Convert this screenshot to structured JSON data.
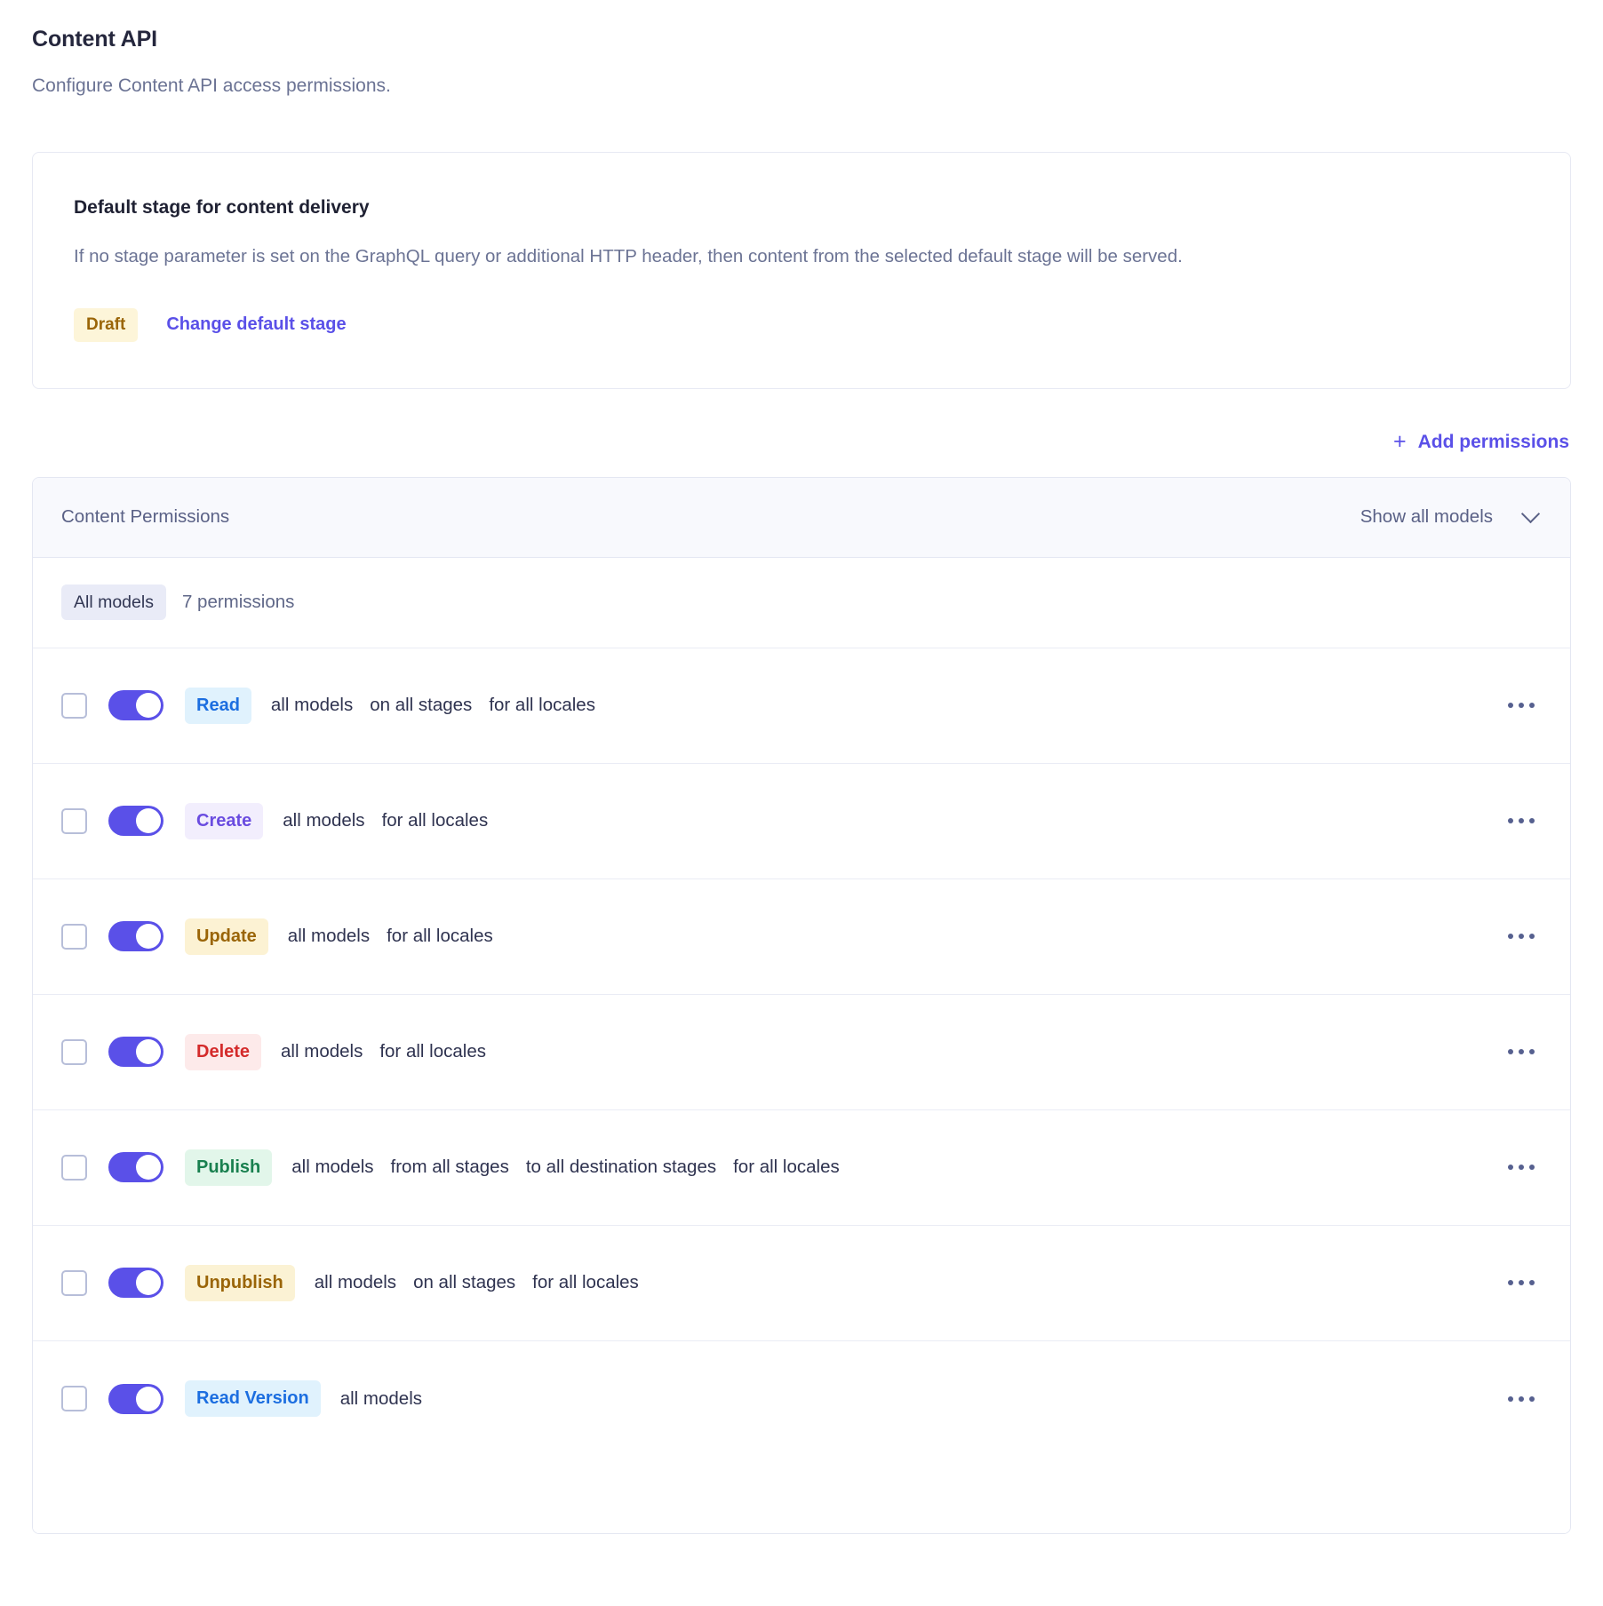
{
  "page": {
    "title": "Content API",
    "subtitle": "Configure Content API access permissions."
  },
  "default_stage_card": {
    "title": "Default stage for content delivery",
    "description": "If no stage parameter is set on the GraphQL query or additional HTTP header, then content from the selected default stage will be served.",
    "stage_badge": "Draft",
    "change_link": "Change default stage"
  },
  "add_permissions": {
    "icon": "plus-icon",
    "label": "Add permissions"
  },
  "permissions_panel": {
    "header_title": "Content Permissions",
    "filter_label": "Show all models",
    "filter_icon": "chevron-down-icon",
    "scope_chip": "All models",
    "count_label": "7 permissions",
    "row_menu_icon": "ellipsis-icon",
    "rows": [
      {
        "action": "Read",
        "action_color": "#1c6ee0",
        "action_bg": "#e0f2fd",
        "toggle_on": true,
        "checked": false,
        "scopes": [
          "all models",
          "on all stages",
          "for all locales"
        ]
      },
      {
        "action": "Create",
        "action_color": "#6a4ce0",
        "action_bg": "#f2eefd",
        "toggle_on": true,
        "checked": false,
        "scopes": [
          "all models",
          "for all locales"
        ]
      },
      {
        "action": "Update",
        "action_color": "#9a6508",
        "action_bg": "#fcf2d3",
        "toggle_on": true,
        "checked": false,
        "scopes": [
          "all models",
          "for all locales"
        ]
      },
      {
        "action": "Delete",
        "action_color": "#d42b2b",
        "action_bg": "#fdeaea",
        "toggle_on": true,
        "checked": false,
        "scopes": [
          "all models",
          "for all locales"
        ]
      },
      {
        "action": "Publish",
        "action_color": "#19804f",
        "action_bg": "#e2f6ea",
        "toggle_on": true,
        "checked": false,
        "scopes": [
          "all models",
          "from all stages",
          "to all destination stages",
          "for all locales"
        ]
      },
      {
        "action": "Unpublish",
        "action_color": "#9a6508",
        "action_bg": "#fbf2d4",
        "toggle_on": true,
        "checked": false,
        "scopes": [
          "all models",
          "on all stages",
          "for all locales"
        ]
      },
      {
        "action": "Read Version",
        "action_color": "#1c6ee0",
        "action_bg": "#e0f2fd",
        "toggle_on": true,
        "checked": false,
        "scopes": [
          "all models"
        ]
      }
    ]
  },
  "colors": {
    "accent": "#5a50e8",
    "text_primary": "#25273d",
    "text_muted": "#6b7394",
    "panel_header_bg": "#f8f9fd",
    "border": "#e4e7f2"
  }
}
